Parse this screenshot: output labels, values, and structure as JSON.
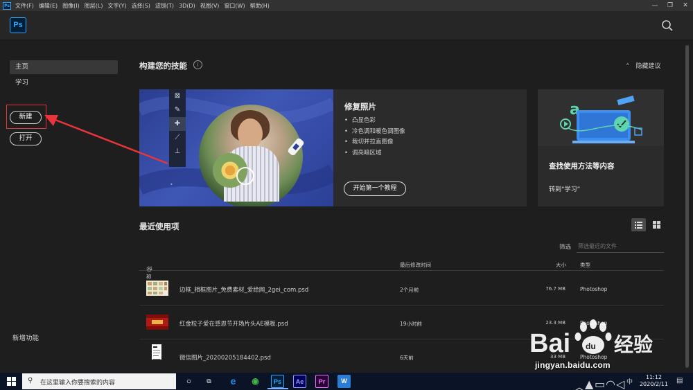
{
  "menubar": {
    "app_icon": "Ps",
    "items": [
      "文件(F)",
      "编辑(E)",
      "图像(I)",
      "图层(L)",
      "文字(Y)",
      "选择(S)",
      "滤镜(T)",
      "3D(D)",
      "视图(V)",
      "窗口(W)",
      "帮助(H)"
    ],
    "window_controls": [
      "—",
      "❐",
      "✕"
    ]
  },
  "header": {
    "logo": "Ps",
    "search_icon": "search-icon"
  },
  "sidebar": {
    "items": [
      {
        "label": "主页",
        "active": true
      },
      {
        "label": "学习",
        "active": false
      }
    ],
    "new_button": "新建",
    "open_button": "打开",
    "new_features": "新增功能"
  },
  "skills": {
    "title": "构建您的技能",
    "hide_label": "隐藏建议",
    "card1": {
      "title": "修复照片",
      "bullets": [
        "凸显色彩",
        "冷色调和暖色调图像",
        "裁切并拉直图像",
        "调亮暗区域"
      ],
      "cta": "开始第一个教程"
    },
    "card2": {
      "title": "查找使用方法等内容",
      "link": "转到“学习”"
    }
  },
  "recent": {
    "title": "最近使用项",
    "filter_label": "筛选",
    "filter_placeholder": "筛选最近的文件",
    "columns": {
      "name": "名称",
      "modified": "最后修改时间",
      "size": "大小",
      "type": "类型"
    },
    "rows": [
      {
        "name": "边框_相框图片_免费素材_爱给网_2gei_com.psd",
        "modified": "2个月前",
        "size": "76.7 MB",
        "type": "Photoshop"
      },
      {
        "name": "红金粒子爱在感恩节开场片头AE模板.psd",
        "modified": "19小时前",
        "size": "23.3 MB",
        "type": "Photoshop"
      },
      {
        "name": "微信图片_20200205184402.psd",
        "modified": "6天前",
        "size": "33 MB",
        "type": "Photoshop"
      }
    ]
  },
  "watermark": {
    "brand": "Bai经验",
    "url": "jingyan.baidu.com"
  },
  "taskbar": {
    "search_placeholder": "在这里输入你要搜索的内容",
    "apps": [
      {
        "icon": "edge-icon",
        "label": "e",
        "color": "#1f8fe6"
      },
      {
        "icon": "browser-icon",
        "label": "◉",
        "color": "#41b548"
      },
      {
        "icon": "photoshop-icon",
        "label": "Ps",
        "color": "#31a8ff"
      },
      {
        "icon": "after-effects-icon",
        "label": "Ae",
        "color": "#9999ff"
      },
      {
        "icon": "premiere-icon",
        "label": "Pr",
        "color": "#ea77ff"
      },
      {
        "icon": "word-icon",
        "label": "W",
        "color": "#2b7cd3"
      }
    ],
    "ime": "中",
    "time": "11:12",
    "date": "2020/2/11"
  }
}
